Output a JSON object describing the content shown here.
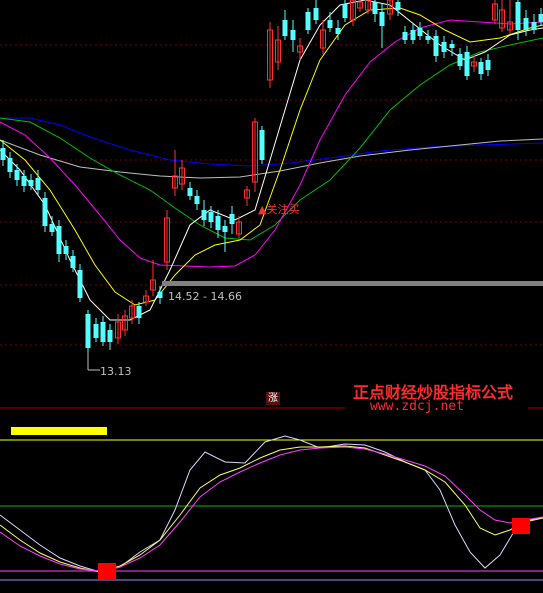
{
  "chart": {
    "range_label": "14.52 - 14.66",
    "low_label": "13.13",
    "signal_label": "▲关注买",
    "zhang_badge": "涨",
    "watermark_title": "正点财经炒股指标公式",
    "watermark_url": "www.zdcj.net"
  },
  "colors": {
    "background": "#000000",
    "candle_up": "#ff3232",
    "candle_down": "#54ffff",
    "ma_white": "#ffffff",
    "ma_yellow": "#ffff00",
    "ma_magenta": "#ff00ff",
    "ma_green": "#00c000",
    "ma_blue": "#0000ff",
    "ma_gray": "#bdbdbd",
    "grid_red": "#7a0000",
    "level_bar": "#808080",
    "yellow_bar": "#ffff00",
    "osc_white": "#d8d8ff",
    "osc_yellow": "#ffff66",
    "osc_magenta": "#ff40ff",
    "marker_red": "#ff0000"
  },
  "indicator": {
    "upper_level": 80,
    "mid_level": 50,
    "lower_level": 20
  }
}
